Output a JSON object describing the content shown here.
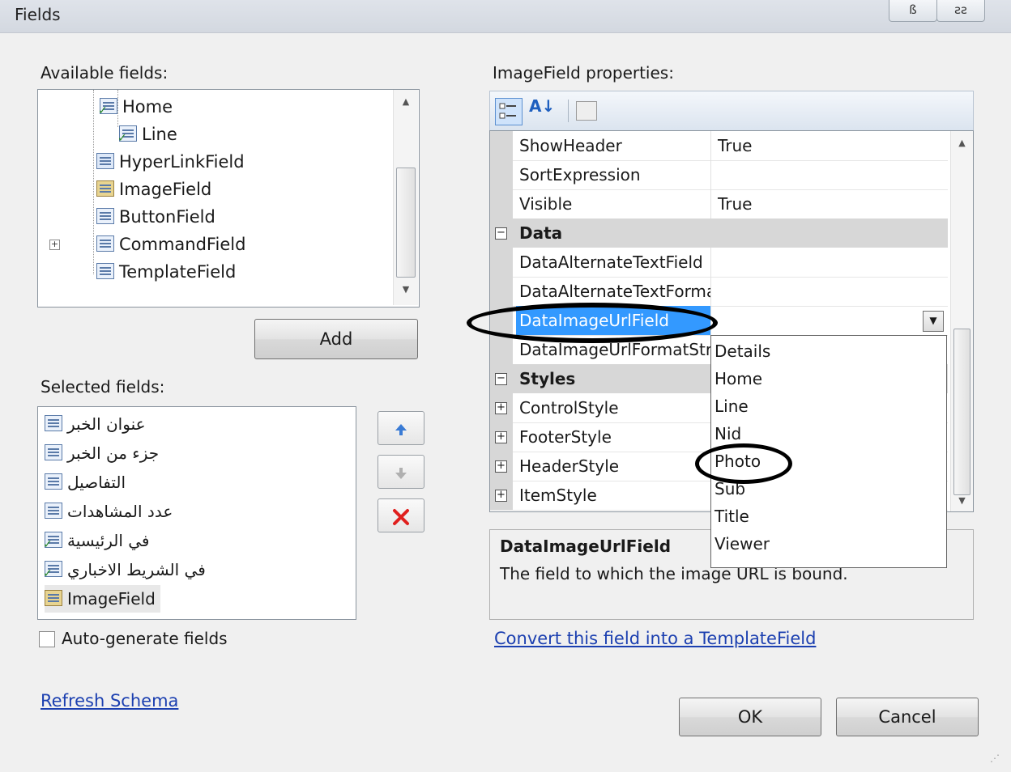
{
  "window": {
    "title": "Fields",
    "minimize_glyph": "ß",
    "restore_glyph": "ƨƨ"
  },
  "available": {
    "label": "Available fields:",
    "items": [
      {
        "label": "Home",
        "icon": "bound-field-check-icon"
      },
      {
        "label": "Line",
        "icon": "bound-field-check-icon"
      },
      {
        "label": "HyperLinkField",
        "icon": "hyperlink-field-icon"
      },
      {
        "label": "ImageField",
        "icon": "image-field-icon"
      },
      {
        "label": "ButtonField",
        "icon": "button-field-icon"
      },
      {
        "label": "CommandField",
        "icon": "command-field-icon"
      },
      {
        "label": "TemplateField",
        "icon": "template-field-icon"
      }
    ],
    "add_label": "Add"
  },
  "selected": {
    "label": "Selected fields:",
    "items": [
      {
        "label": "عنوان الخبر",
        "icon": "bound-field-icon"
      },
      {
        "label": "جزء من الخبر",
        "icon": "bound-field-icon"
      },
      {
        "label": "التفاصيل",
        "icon": "bound-field-icon"
      },
      {
        "label": "عدد المشاهدات",
        "icon": "bound-field-icon"
      },
      {
        "label": "في الرئيسية",
        "icon": "checkbox-field-icon"
      },
      {
        "label": "في الشريط الاخباري",
        "icon": "checkbox-field-icon"
      },
      {
        "label": "ImageField",
        "icon": "image-field-icon"
      }
    ],
    "move_up_icon": "up-arrow-icon",
    "move_down_icon": "down-arrow-icon",
    "delete_icon": "red-x-delete-icon"
  },
  "autogen": {
    "label": "Auto-generate fields",
    "checked": false
  },
  "refresh_label": "Refresh Schema",
  "properties": {
    "label": "ImageField properties:",
    "toolbar": {
      "categorized_icon": "categorized-icon",
      "alphabetical_glyph": "A↓",
      "pages_icon": "property-pages-icon"
    },
    "rows": [
      {
        "name": "ShowHeader",
        "value": "True"
      },
      {
        "name": "SortExpression",
        "value": ""
      },
      {
        "name": "Visible",
        "value": "True"
      }
    ],
    "cat_data": "Data",
    "data_rows": [
      {
        "name": "DataAlternateTextField",
        "value": ""
      },
      {
        "name": "DataAlternateTextFormat",
        "value": ""
      },
      {
        "name": "DataImageUrlField",
        "value": ""
      },
      {
        "name": "DataImageUrlFormatString",
        "value": ""
      }
    ],
    "cat_styles": "Styles",
    "style_rows": [
      {
        "name": "ControlStyle"
      },
      {
        "name": "FooterStyle"
      },
      {
        "name": "HeaderStyle"
      },
      {
        "name": "ItemStyle"
      }
    ],
    "dropdown_options": [
      "Details",
      "Home",
      "Line",
      "Nid",
      "Photo",
      "Sub",
      "Title",
      "Viewer"
    ],
    "description_title": "DataImageUrlField",
    "description_text": "The field to which the image URL is bound."
  },
  "convert_label": "Convert this field into a TemplateField",
  "ok_label": "OK",
  "cancel_label": "Cancel",
  "colors": {
    "selection": "#3399ff",
    "link": "#1b3fb0"
  }
}
